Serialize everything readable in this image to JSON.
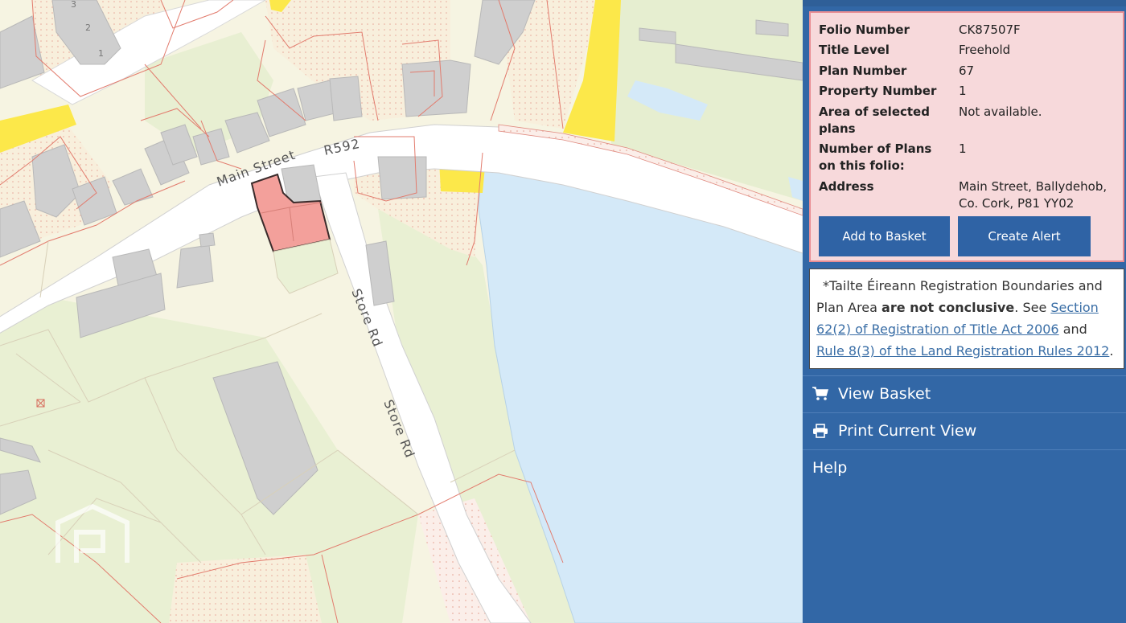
{
  "map": {
    "labels": {
      "main_street": "Main Street",
      "r592": "R592",
      "store_rd_1": "Store Rd",
      "store_rd_2": "Store Rd",
      "house_3": "3",
      "house_2": "2",
      "house_1": "1"
    }
  },
  "info": {
    "rows": [
      {
        "key": "Folio Number",
        "value": "CK87507F"
      },
      {
        "key": "Title Level",
        "value": "Freehold"
      },
      {
        "key": "Plan Number",
        "value": "67"
      },
      {
        "key": "Property Number",
        "value": "1"
      },
      {
        "key": "Area of selected plans",
        "value": "Not available."
      },
      {
        "key": "Number of Plans on this folio:",
        "value": "1"
      },
      {
        "key": "Address",
        "value": "Main Street, Ballydehob, Co. Cork, P81 YY02"
      }
    ],
    "add_to_basket": "Add to Basket",
    "create_alert": "Create Alert"
  },
  "notice": {
    "part1": "*Tailte Éireann Registration Boundaries and Plan Area ",
    "bold": "are not conclusive",
    "part2": ". See ",
    "link1": "Section 62(2) of Registration of Title Act 2006",
    "part3": " and ",
    "link2": "Rule 8(3) of the Land Registration Rules 2012",
    "part4": "."
  },
  "nav": {
    "view_basket": "View Basket",
    "print_view": "Print Current View",
    "help": "Help"
  },
  "colors": {
    "panel": "#3267a6",
    "info_bg": "#f7d9db",
    "highlight": "#f3a09b",
    "water": "#d4e9f8",
    "yellow": "#fce84a"
  },
  "icons": [
    "cart-icon",
    "printer-icon",
    "watermark-logo"
  ]
}
